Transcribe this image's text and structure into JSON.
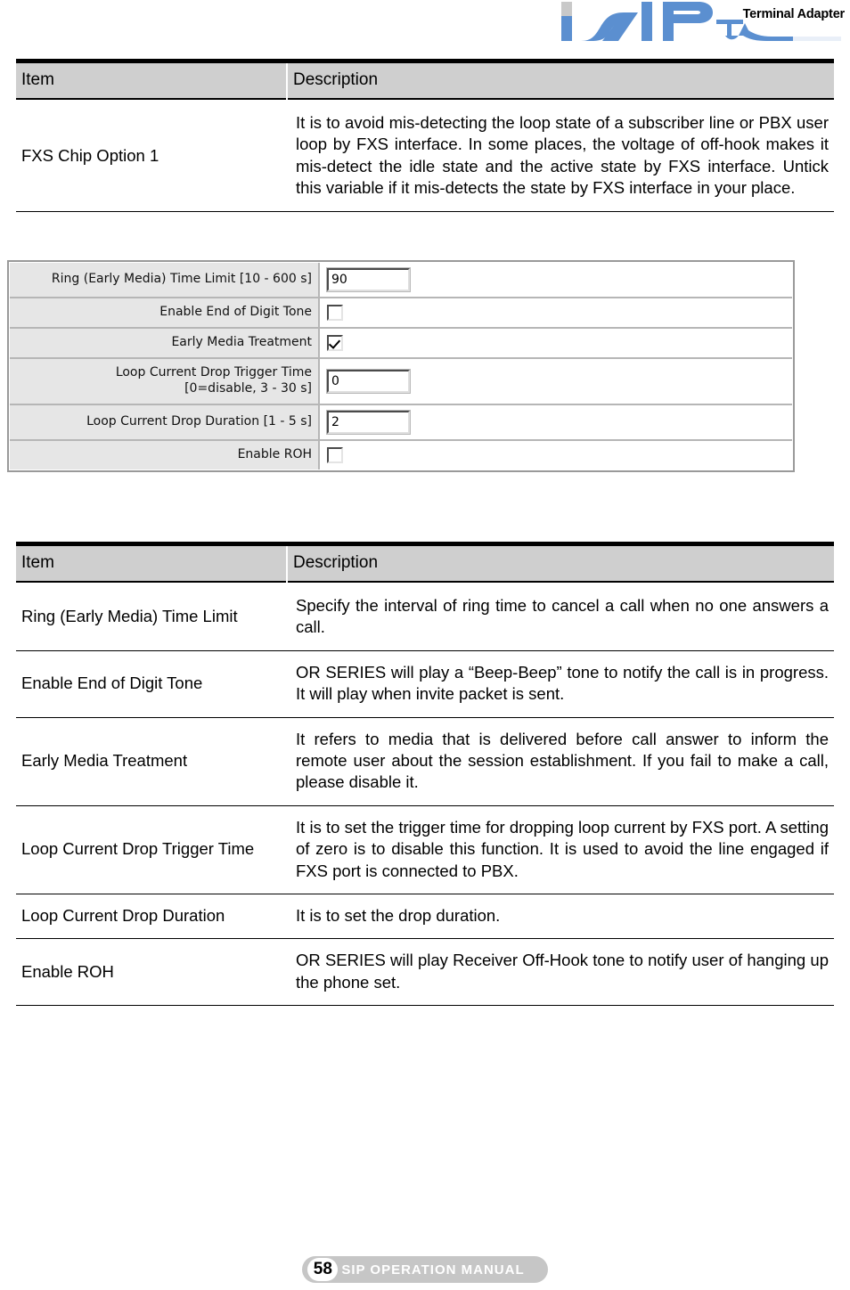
{
  "header": {
    "logo_alt": "SIP TA",
    "brand_tag": "Terminal Adapter"
  },
  "table_top": {
    "columns": [
      "Item",
      "Description"
    ],
    "rows": [
      {
        "item": "FXS Chip Option 1",
        "description": "It is to avoid mis-detecting the loop state of a subscriber line or PBX user loop by FXS interface. In some places, the voltage of off-hook makes it mis-detect the idle state and the active state by FXS interface. Untick this variable if it mis-detects the state by FXS interface in your place."
      }
    ]
  },
  "config_panel": {
    "rows": [
      {
        "label": "Ring (Early Media) Time Limit [10 - 600 s]",
        "label_line2": "",
        "type": "text",
        "value": "90"
      },
      {
        "label": "Enable End of Digit Tone",
        "label_line2": "",
        "type": "checkbox",
        "checked": "false"
      },
      {
        "label": "Early Media Treatment",
        "label_line2": "",
        "type": "checkbox",
        "checked": "true"
      },
      {
        "label": "Loop Current Drop Trigger Time",
        "label_line2": "[0=disable, 3 - 30 s]",
        "type": "text",
        "value": "0"
      },
      {
        "label": "Loop Current Drop Duration [1 - 5 s]",
        "label_line2": "",
        "type": "text",
        "value": "2"
      },
      {
        "label": "Enable ROH",
        "label_line2": "",
        "type": "checkbox",
        "checked": "false"
      }
    ]
  },
  "table_bottom": {
    "columns": [
      "Item",
      "Description"
    ],
    "rows": [
      {
        "item": "Ring (Early Media) Time Limit",
        "description": "Specify the interval of ring time to cancel a call when no one answers a call."
      },
      {
        "item": "Enable End of Digit Tone",
        "description": "OR SERIES will play a “Beep-Beep” tone to notify the call is in progress. It will play when invite packet is sent."
      },
      {
        "item": "Early Media Treatment",
        "description": "It refers to media that is delivered before call answer to inform the remote user about the session establishment. If you fail to make a call, please disable it."
      },
      {
        "item": "Loop Current Drop Trigger Time",
        "description": "It is to set the trigger time for dropping loop current by FXS port. A setting of zero is to disable this function. It is used to avoid the line engaged if FXS port is connected to PBX."
      },
      {
        "item": "Loop Current Drop Duration",
        "description": "It is to set the drop duration."
      },
      {
        "item": "Enable ROH",
        "description": "OR SERIES will play Receiver Off-Hook tone to notify user of hanging up the phone set."
      }
    ]
  },
  "footer": {
    "page_number": "58",
    "manual_title": "SIP OPERATION MANUAL"
  },
  "colors": {
    "logo_blue": "#5b8fd0",
    "table_header_bg": "#cfcfcf",
    "panel_label_bg": "#e6e6e6",
    "footer_pill": "#c6c6c6"
  }
}
